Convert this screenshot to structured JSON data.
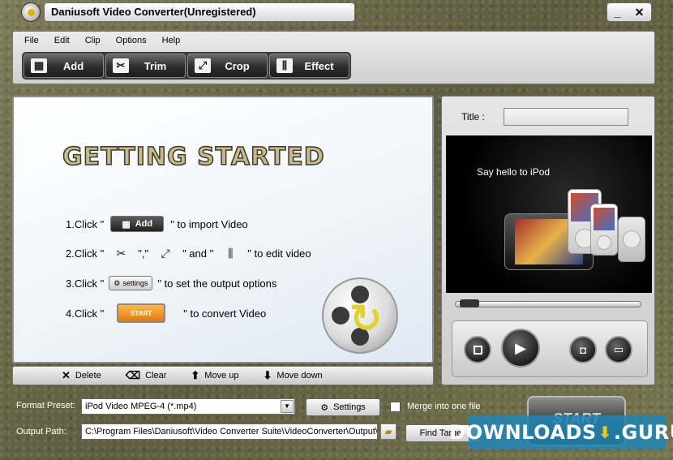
{
  "window": {
    "title": "Daniusoft Video Converter(Unregistered)",
    "minimize_label": "_",
    "close_label": "✕"
  },
  "menu": [
    {
      "label": "File"
    },
    {
      "label": "Edit"
    },
    {
      "label": "Clip"
    },
    {
      "label": "Options"
    },
    {
      "label": "Help"
    }
  ],
  "toolbar": {
    "add": "Add",
    "trim": "Trim",
    "crop": "Crop",
    "effect": "Effect"
  },
  "getting_started": {
    "title": "GETTING STARTED",
    "steps": {
      "s1_pre": "1.Click \"",
      "s1_btn": "Add",
      "s1_post": "\" to import Video",
      "s2_pre": "2.Click \"",
      "s2_mid1": "\",\"",
      "s2_mid2": "\" and \"",
      "s2_post": "\" to edit video",
      "s3_pre": "3.Click \"",
      "s3_btn": "settings",
      "s3_post": "\" to set the output options",
      "s4_pre": "4.Click \"",
      "s4_btn": "START",
      "s4_post": "\" to convert Video"
    }
  },
  "list_actions": {
    "delete": "Delete",
    "clear": "Clear",
    "move_up": "Move up",
    "move_down": "Move down"
  },
  "preview": {
    "title_label": "Title :",
    "title_value": "",
    "caption": "Say hello to iPod",
    "progress": 0.02
  },
  "output": {
    "format_label": "Format Preset:",
    "format_value": "iPod Video MPEG-4 (*.mp4)",
    "settings_label": "Settings",
    "merge_label": "Merge into one file",
    "merge_checked": false,
    "path_label": "Output Path:",
    "path_value": "C:\\Program Files\\Daniusoft\\Video Converter Suite\\VideoConverter\\Output\\",
    "find_target_label": "Find Target",
    "start_label": "START"
  },
  "watermark": {
    "left": "DOWNLOADS",
    "right": "GURU"
  }
}
